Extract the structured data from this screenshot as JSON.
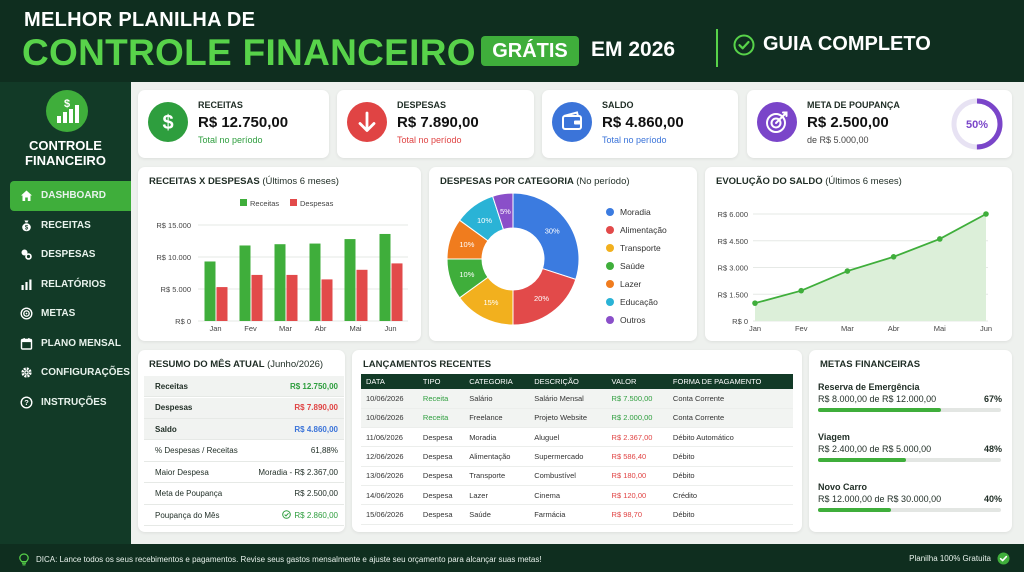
{
  "header": {
    "line1": "MELHOR PLANILHA DE",
    "line2": "CONTROLE FINANCEIRO",
    "badge": "GRÁTIS",
    "year": "EM 2026",
    "guide": "GUIA COMPLETO"
  },
  "sidebar": {
    "title_line1": "CONTROLE",
    "title_line2": "FINANCEIRO",
    "items": [
      {
        "label": "DASHBOARD",
        "icon": "home-icon",
        "active": true
      },
      {
        "label": "RECEITAS",
        "icon": "money-bag-icon"
      },
      {
        "label": "DESPESAS",
        "icon": "coins-icon"
      },
      {
        "label": "RELATÓRIOS",
        "icon": "bar-chart-icon"
      },
      {
        "label": "METAS",
        "icon": "target-icon"
      },
      {
        "label": "PLANO MENSAL",
        "icon": "calendar-icon"
      },
      {
        "label": "CONFIGURAÇÕES",
        "icon": "gear-icon"
      },
      {
        "label": "INSTRUÇÕES",
        "icon": "help-icon"
      }
    ]
  },
  "kpis": [
    {
      "label": "RECEITAS",
      "value": "R$ 12.750,00",
      "sub": "Total no período",
      "color": "#2e9e3e",
      "icon": "dollar-icon"
    },
    {
      "label": "DESPESAS",
      "value": "R$ 7.890,00",
      "sub": "Total no período",
      "color": "#e04444",
      "icon": "arrow-down-icon"
    },
    {
      "label": "SALDO",
      "value": "R$ 4.860,00",
      "sub": "Total no período",
      "color": "#3b74d9",
      "icon": "wallet-icon"
    },
    {
      "label": "META DE POUPANÇA",
      "value": "R$ 2.500,00",
      "sub": "de R$ 5.000,00",
      "color": "#7a45c9",
      "icon": "target-icon",
      "progress_label": "50%",
      "progress": 0.5
    }
  ],
  "charts": {
    "income_expense": {
      "title": "RECEITAS X DESPESAS",
      "subtitle": "(Últimos 6 meses)",
      "legend": [
        "Receitas",
        "Despesas"
      ],
      "ticks": [
        "R$ 15.000",
        "R$ 10.000",
        "R$ 5.000",
        "R$ 0"
      ]
    },
    "category": {
      "title": "DESPESAS POR CATEGORIA",
      "subtitle": "(No período)"
    },
    "balance": {
      "title": "EVOLUÇÃO DO SALDO",
      "subtitle": "(Últimos 6 meses)",
      "ticks": [
        "R$ 6.000",
        "R$ 4.500",
        "R$ 3.000",
        "R$ 1.500",
        "R$ 0"
      ]
    }
  },
  "chart_data": [
    {
      "type": "bar",
      "categories": [
        "Jan",
        "Fev",
        "Mar",
        "Abr",
        "Mai",
        "Jun"
      ],
      "series": [
        {
          "name": "Receitas",
          "values": [
            9300,
            11800,
            12000,
            12100,
            12800,
            13600
          ],
          "color": "#3fae3b"
        },
        {
          "name": "Despesas",
          "values": [
            5300,
            7200,
            7200,
            6500,
            8000,
            9000
          ],
          "color": "#e24a4a"
        }
      ],
      "ylim": [
        0,
        15000
      ],
      "grid": true,
      "legend": "top-center"
    },
    {
      "type": "pie",
      "donut": true,
      "categories": [
        "Moradia",
        "Alimentação",
        "Transporte",
        "Saúde",
        "Lazer",
        "Educação",
        "Outros"
      ],
      "values": [
        30,
        20,
        15,
        10,
        10,
        10,
        5
      ],
      "labels": [
        "30%",
        "20%",
        "15%",
        "10%",
        "10%",
        "10%",
        "5%"
      ],
      "colors": [
        "#3b7be0",
        "#e24a4a",
        "#f2b01e",
        "#3fae3b",
        "#f07c1e",
        "#2ab3d6",
        "#8a4fc9"
      ],
      "legend": "right"
    },
    {
      "type": "area",
      "x": [
        "Jan",
        "Fev",
        "Mar",
        "Abr",
        "Mai",
        "Jun"
      ],
      "series": [
        {
          "values": [
            1000,
            1700,
            2800,
            3600,
            4600,
            6000
          ],
          "color": "#3fae3b"
        }
      ],
      "ylim": [
        0,
        6000
      ],
      "grid": true
    }
  ],
  "summary": {
    "title": "RESUMO DO MÊS ATUAL",
    "subtitle": "(Junho/2026)",
    "rows": [
      {
        "label": "Receitas",
        "value": "R$ 12.750,00",
        "color": "#2e9e3e",
        "shade": true
      },
      {
        "label": "Despesas",
        "value": "R$ 7.890,00",
        "color": "#e04444",
        "shade": true
      },
      {
        "label": "Saldo",
        "value": "R$ 4.860,00",
        "color": "#3b74d9",
        "shade": true
      },
      {
        "label": "% Despesas / Receitas",
        "value": "61,88%",
        "color": "#1f2d25"
      },
      {
        "label": "Maior Despesa",
        "value": "Moradia - R$ 2.367,00",
        "color": "#1f2d25"
      },
      {
        "label": "Meta de Poupança",
        "value": "R$ 2.500,00",
        "color": "#1f2d25"
      },
      {
        "label": "Poupança do Mês",
        "value": "R$ 2.860,00",
        "color": "#2e9e3e",
        "check": true
      }
    ]
  },
  "transactions": {
    "title": "LANÇAMENTOS RECENTES",
    "columns": [
      "DATA",
      "TIPO",
      "CATEGORIA",
      "DESCRIÇÃO",
      "VALOR",
      "FORMA DE PAGAMENTO"
    ],
    "rows": [
      [
        "10/06/2026",
        "Receita",
        "Salário",
        "Salário Mensal",
        "R$ 7.500,00",
        "Conta Corrente"
      ],
      [
        "10/06/2026",
        "Receita",
        "Freelance",
        "Projeto Website",
        "R$ 2.000,00",
        "Conta Corrente"
      ],
      [
        "11/06/2026",
        "Despesa",
        "Moradia",
        "Aluguel",
        "R$ 2.367,00",
        "Débito Automático"
      ],
      [
        "12/06/2026",
        "Despesa",
        "Alimentação",
        "Supermercado",
        "R$ 586,40",
        "Débito"
      ],
      [
        "13/06/2026",
        "Despesa",
        "Transporte",
        "Combustível",
        "R$ 180,00",
        "Débito"
      ],
      [
        "14/06/2026",
        "Despesa",
        "Lazer",
        "Cinema",
        "R$ 120,00",
        "Crédito"
      ],
      [
        "15/06/2026",
        "Despesa",
        "Saúde",
        "Farmácia",
        "R$ 98,70",
        "Débito"
      ]
    ]
  },
  "goals": {
    "title": "METAS FINANCEIRAS",
    "items": [
      {
        "name": "Reserva de Emergência",
        "amount": "R$ 8.000,00 de R$ 12.000,00",
        "pct": "67%",
        "progress": 0.67
      },
      {
        "name": "Viagem",
        "amount": "R$ 2.400,00 de R$ 5.000,00",
        "pct": "48%",
        "progress": 0.48
      },
      {
        "name": "Novo Carro",
        "amount": "R$ 12.000,00 de R$ 30.000,00",
        "pct": "40%",
        "progress": 0.4
      }
    ]
  },
  "footer": {
    "tip": "DICA: Lance todos os seus recebimentos e pagamentos. Revise seus gastos mensalmente e ajuste seu orçamento para alcançar suas metas!",
    "free": "Planilha 100% Gratuita"
  }
}
